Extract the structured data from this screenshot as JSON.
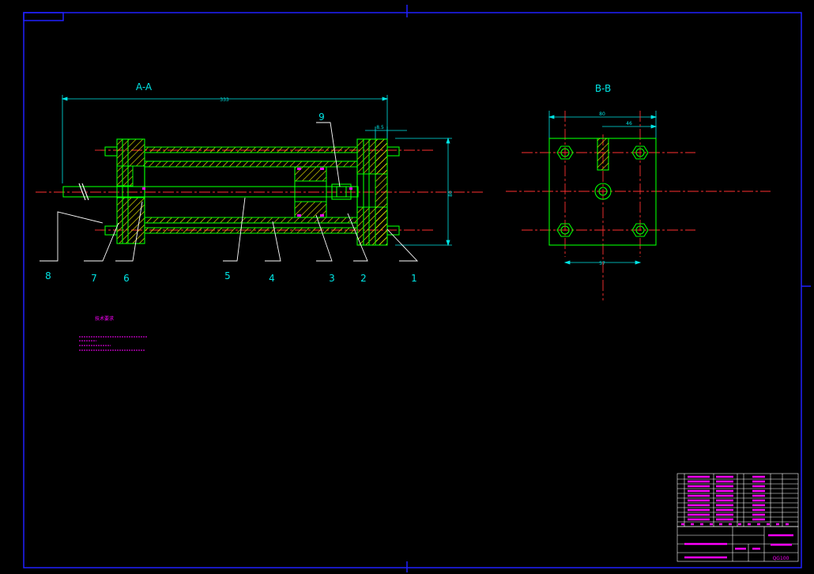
{
  "drawing": {
    "view_a_title": "A-A",
    "view_b_title": "B-B",
    "part_labels": [
      "1",
      "2",
      "3",
      "4",
      "5",
      "6",
      "7",
      "8",
      "9"
    ],
    "dim_overall": "333",
    "dim_top_right": "8.5",
    "dim_height": "80",
    "dim_b_width": "80",
    "dim_b_half": "46",
    "dim_b_bottom": "57",
    "tech_req_title": "技术要求",
    "drawing_number": "QG100",
    "colors": {
      "background": "#000000",
      "outline": "#00ff00",
      "hatch": "#ffff00",
      "center_line": "#ff3030",
      "dimension": "#00e5e5",
      "annotation": "#ff00ff",
      "frame": "#2020ff",
      "leader": "#ffffff"
    }
  }
}
